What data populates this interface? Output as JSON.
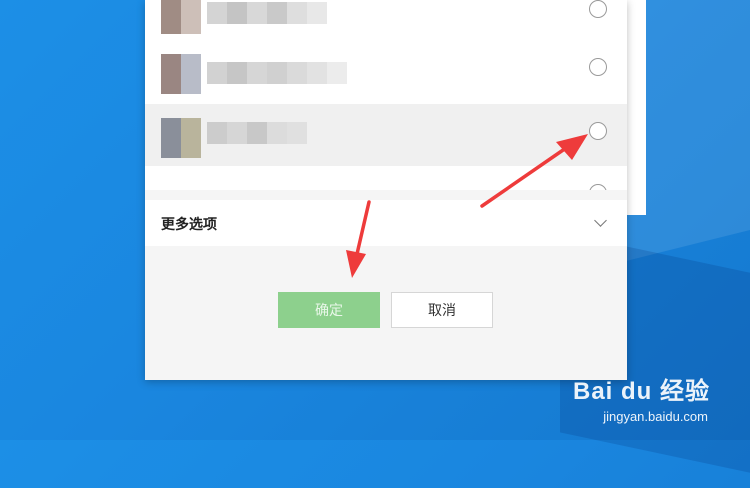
{
  "dialog": {
    "more_options_label": "更多选项",
    "confirm_label": "确定",
    "cancel_label": "取消"
  },
  "watermark": {
    "brand": "Bai du 经验",
    "url": "jingyan.baidu.com"
  }
}
